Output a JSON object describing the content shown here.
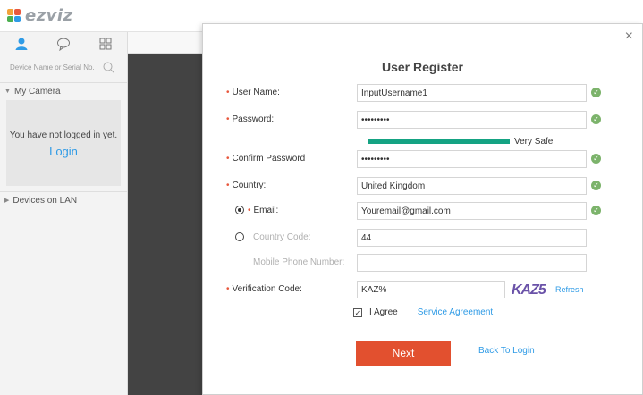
{
  "app": {
    "logo_text": "ezviz"
  },
  "sidebar": {
    "search_placeholder": "Device Name or Serial No.",
    "sections": {
      "my_camera": "My Camera",
      "devices_on_lan": "Devices on LAN"
    },
    "login_message": "You have not logged in yet.",
    "login_link": "Login"
  },
  "dialog": {
    "close": "×",
    "title": "User Register",
    "fields": {
      "username": {
        "label": "User Name:",
        "value": "InputUsername1"
      },
      "password": {
        "label": "Password:",
        "value": "•••••••••"
      },
      "strength": {
        "text": "Very Safe",
        "level": 1.0
      },
      "confirm_password": {
        "label": "Confirm Password",
        "value": "•••••••••"
      },
      "country": {
        "label": "Country:",
        "value": "United Kingdom"
      },
      "email": {
        "label": "Email:",
        "value": "Youremail@gmail.com"
      },
      "country_code": {
        "label": "Country Code:",
        "value": "44"
      },
      "mobile": {
        "label": "Mobile Phone Number:",
        "value": ""
      },
      "verification": {
        "label": "Verification Code:",
        "value": "KAZ%"
      }
    },
    "captcha_text": "KAZ5",
    "refresh": "Refresh",
    "agree": "I Agree",
    "service_agreement": "Service Agreement",
    "next": "Next",
    "back_to_login": "Back To Login"
  },
  "colors": {
    "accent": "#2f9be6",
    "next_button": "#e2502f",
    "strength_bar": "#15a383",
    "check": "#7cb36b"
  }
}
